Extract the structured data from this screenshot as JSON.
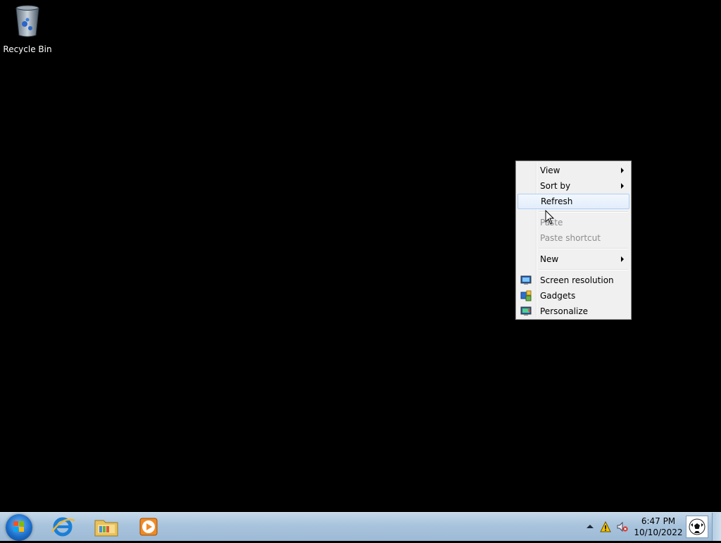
{
  "desktop": {
    "icons": [
      {
        "label": "Recycle Bin",
        "icon": "recycle-bin-icon"
      }
    ]
  },
  "context_menu": {
    "items": [
      {
        "label": "View",
        "submenu": true,
        "enabled": true
      },
      {
        "label": "Sort by",
        "submenu": true,
        "enabled": true
      },
      {
        "label": "Refresh",
        "submenu": false,
        "enabled": true,
        "highlighted": true
      },
      {
        "label": "Paste",
        "submenu": false,
        "enabled": false
      },
      {
        "label": "Paste shortcut",
        "submenu": false,
        "enabled": false
      },
      {
        "label": "New",
        "submenu": true,
        "enabled": true
      },
      {
        "label": "Screen resolution",
        "icon": "monitor-icon",
        "enabled": true
      },
      {
        "label": "Gadgets",
        "icon": "gadgets-icon",
        "enabled": true
      },
      {
        "label": "Personalize",
        "icon": "personalize-icon",
        "enabled": true
      }
    ]
  },
  "taskbar": {
    "start": {
      "icon": "windows-start-orb-icon"
    },
    "pinned": [
      {
        "name": "Internet Explorer",
        "icon": "internet-explorer-icon"
      },
      {
        "name": "Windows Explorer",
        "icon": "folder-library-icon"
      },
      {
        "name": "Windows Media Player",
        "icon": "media-player-icon"
      }
    ],
    "tray": {
      "icons": [
        "show-hidden-icons-arrow-icon",
        "action-center-warning-icon",
        "volume-muted-icon"
      ],
      "time": "6:47 PM",
      "date": "10/10/2022",
      "user_icon": "soccer-ball-icon"
    }
  },
  "colors": {
    "desktop_bg": "#000000",
    "menu_bg": "#f0f0f0",
    "highlight_border": "#aecff7",
    "taskbar": "#a8c3dc"
  }
}
